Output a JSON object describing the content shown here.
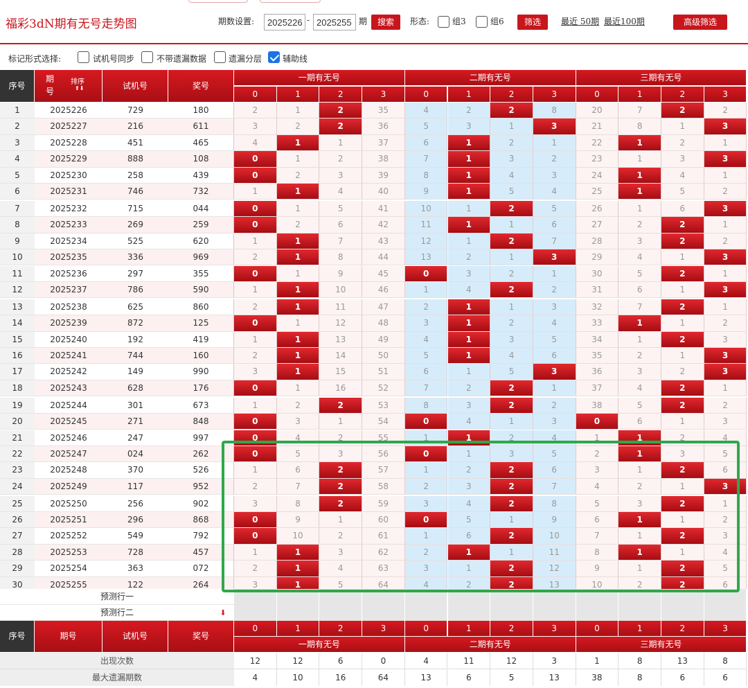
{
  "header": {
    "title": "福彩3dN期有无号走势图",
    "issue_label": "期数设置:",
    "from": "2025226",
    "dash": "-",
    "to": "2025255",
    "period_unit": "期",
    "search_btn": "搜索",
    "shape_label": "形态:",
    "group3": "组3",
    "group6": "组6",
    "filter_btn": "筛选",
    "recent50": "最近 50期",
    "recent100": "最近100期",
    "advanced_btn": "高级筛选"
  },
  "options": {
    "label": "标记形式选择:",
    "items": [
      {
        "label": "试机号同步",
        "checked": false
      },
      {
        "label": "不带遗漏数据",
        "checked": false
      },
      {
        "label": "遗漏分层",
        "checked": false
      },
      {
        "label": "辅助线",
        "checked": true
      }
    ]
  },
  "table": {
    "headers": {
      "seq": "序号",
      "issue": "期号",
      "sort": "排序",
      "test": "试机号",
      "prize": "奖号"
    },
    "groups": [
      "一期有无号",
      "二期有无号",
      "三期有无号"
    ],
    "digits": [
      "0",
      "1",
      "2",
      "3"
    ],
    "rows": [
      {
        "seq": "1",
        "issue": "2025226",
        "test": "729",
        "prize": "180",
        "vals": [
          "2",
          "1",
          "2",
          "35",
          "4",
          "2",
          "2",
          "8",
          "20",
          "7",
          "2",
          "2"
        ],
        "hits": [
          2,
          6,
          10
        ]
      },
      {
        "seq": "2",
        "issue": "2025227",
        "test": "216",
        "prize": "611",
        "vals": [
          "3",
          "2",
          "2",
          "36",
          "5",
          "3",
          "1",
          "3",
          "21",
          "8",
          "1",
          "3"
        ],
        "hits": [
          2,
          7,
          11
        ]
      },
      {
        "seq": "3",
        "issue": "2025228",
        "test": "451",
        "prize": "465",
        "vals": [
          "4",
          "1",
          "1",
          "37",
          "6",
          "1",
          "2",
          "1",
          "22",
          "1",
          "2",
          "1"
        ],
        "hits": [
          1,
          5,
          9
        ]
      },
      {
        "seq": "4",
        "issue": "2025229",
        "test": "888",
        "prize": "108",
        "vals": [
          "0",
          "1",
          "2",
          "38",
          "7",
          "1",
          "3",
          "2",
          "23",
          "1",
          "3",
          "3"
        ],
        "hits": [
          0,
          5,
          11
        ]
      },
      {
        "seq": "5",
        "issue": "2025230",
        "test": "258",
        "prize": "439",
        "vals": [
          "0",
          "2",
          "3",
          "39",
          "8",
          "1",
          "4",
          "3",
          "24",
          "1",
          "4",
          "1"
        ],
        "hits": [
          0,
          5,
          9
        ]
      },
      {
        "seq": "6",
        "issue": "2025231",
        "test": "746",
        "prize": "732",
        "vals": [
          "1",
          "1",
          "4",
          "40",
          "9",
          "1",
          "5",
          "4",
          "25",
          "1",
          "5",
          "2"
        ],
        "hits": [
          1,
          5,
          9
        ]
      },
      {
        "seq": "7",
        "issue": "2025232",
        "test": "715",
        "prize": "044",
        "vals": [
          "0",
          "1",
          "5",
          "41",
          "10",
          "1",
          "2",
          "5",
          "26",
          "1",
          "6",
          "3"
        ],
        "hits": [
          0,
          6,
          11
        ]
      },
      {
        "seq": "8",
        "issue": "2025233",
        "test": "269",
        "prize": "259",
        "vals": [
          "0",
          "2",
          "6",
          "42",
          "11",
          "1",
          "1",
          "6",
          "27",
          "2",
          "2",
          "1"
        ],
        "hits": [
          0,
          5,
          10
        ]
      },
      {
        "seq": "9",
        "issue": "2025234",
        "test": "525",
        "prize": "620",
        "vals": [
          "1",
          "1",
          "7",
          "43",
          "12",
          "1",
          "2",
          "7",
          "28",
          "3",
          "2",
          "2"
        ],
        "hits": [
          1,
          6,
          10
        ]
      },
      {
        "seq": "10",
        "issue": "2025235",
        "test": "336",
        "prize": "969",
        "vals": [
          "2",
          "1",
          "8",
          "44",
          "13",
          "2",
          "1",
          "3",
          "29",
          "4",
          "1",
          "3"
        ],
        "hits": [
          1,
          7,
          11
        ]
      },
      {
        "seq": "11",
        "issue": "2025236",
        "test": "297",
        "prize": "355",
        "vals": [
          "0",
          "1",
          "9",
          "45",
          "0",
          "3",
          "2",
          "1",
          "30",
          "5",
          "2",
          "1"
        ],
        "hits": [
          0,
          4,
          10
        ]
      },
      {
        "seq": "12",
        "issue": "2025237",
        "test": "786",
        "prize": "590",
        "vals": [
          "1",
          "1",
          "10",
          "46",
          "1",
          "4",
          "2",
          "2",
          "31",
          "6",
          "1",
          "3"
        ],
        "hits": [
          1,
          6,
          11
        ]
      },
      {
        "seq": "13",
        "issue": "2025238",
        "test": "625",
        "prize": "860",
        "vals": [
          "2",
          "1",
          "11",
          "47",
          "2",
          "1",
          "1",
          "3",
          "32",
          "7",
          "2",
          "1"
        ],
        "hits": [
          1,
          5,
          10
        ]
      },
      {
        "seq": "14",
        "issue": "2025239",
        "test": "872",
        "prize": "125",
        "vals": [
          "0",
          "1",
          "12",
          "48",
          "3",
          "1",
          "2",
          "4",
          "33",
          "1",
          "1",
          "2"
        ],
        "hits": [
          0,
          5,
          9
        ]
      },
      {
        "seq": "15",
        "issue": "2025240",
        "test": "192",
        "prize": "419",
        "vals": [
          "1",
          "1",
          "13",
          "49",
          "4",
          "1",
          "3",
          "5",
          "34",
          "1",
          "2",
          "3"
        ],
        "hits": [
          1,
          5,
          10
        ]
      },
      {
        "seq": "16",
        "issue": "2025241",
        "test": "744",
        "prize": "160",
        "vals": [
          "2",
          "1",
          "14",
          "50",
          "5",
          "1",
          "4",
          "6",
          "35",
          "2",
          "1",
          "3"
        ],
        "hits": [
          1,
          5,
          11
        ]
      },
      {
        "seq": "17",
        "issue": "2025242",
        "test": "149",
        "prize": "990",
        "vals": [
          "3",
          "1",
          "15",
          "51",
          "6",
          "1",
          "5",
          "3",
          "36",
          "3",
          "2",
          "3"
        ],
        "hits": [
          1,
          7,
          11
        ]
      },
      {
        "seq": "18",
        "issue": "2025243",
        "test": "628",
        "prize": "176",
        "vals": [
          "0",
          "1",
          "16",
          "52",
          "7",
          "2",
          "2",
          "1",
          "37",
          "4",
          "2",
          "1"
        ],
        "hits": [
          0,
          6,
          10
        ]
      },
      {
        "seq": "19",
        "issue": "2025244",
        "test": "301",
        "prize": "673",
        "vals": [
          "1",
          "2",
          "2",
          "53",
          "8",
          "3",
          "2",
          "2",
          "38",
          "5",
          "2",
          "2"
        ],
        "hits": [
          2,
          6,
          10
        ]
      },
      {
        "seq": "20",
        "issue": "2025245",
        "test": "271",
        "prize": "848",
        "vals": [
          "0",
          "3",
          "1",
          "54",
          "0",
          "4",
          "1",
          "3",
          "0",
          "6",
          "1",
          "3"
        ],
        "hits": [
          0,
          4,
          8
        ]
      },
      {
        "seq": "21",
        "issue": "2025246",
        "test": "247",
        "prize": "997",
        "vals": [
          "0",
          "4",
          "2",
          "55",
          "1",
          "1",
          "2",
          "4",
          "1",
          "1",
          "2",
          "4"
        ],
        "hits": [
          0,
          5,
          9
        ]
      },
      {
        "seq": "22",
        "issue": "2025247",
        "test": "024",
        "prize": "262",
        "vals": [
          "0",
          "5",
          "3",
          "56",
          "0",
          "1",
          "3",
          "5",
          "2",
          "1",
          "3",
          "5"
        ],
        "hits": [
          0,
          4,
          9
        ]
      },
      {
        "seq": "23",
        "issue": "2025248",
        "test": "370",
        "prize": "526",
        "vals": [
          "1",
          "6",
          "2",
          "57",
          "1",
          "2",
          "2",
          "6",
          "3",
          "1",
          "2",
          "6"
        ],
        "hits": [
          2,
          6,
          10
        ]
      },
      {
        "seq": "24",
        "issue": "2025249",
        "test": "117",
        "prize": "952",
        "vals": [
          "2",
          "7",
          "2",
          "58",
          "2",
          "3",
          "2",
          "7",
          "4",
          "2",
          "1",
          "3"
        ],
        "hits": [
          2,
          6,
          11
        ]
      },
      {
        "seq": "25",
        "issue": "2025250",
        "test": "256",
        "prize": "902",
        "vals": [
          "3",
          "8",
          "2",
          "59",
          "3",
          "4",
          "2",
          "8",
          "5",
          "3",
          "2",
          "1"
        ],
        "hits": [
          2,
          6,
          10
        ]
      },
      {
        "seq": "26",
        "issue": "2025251",
        "test": "296",
        "prize": "868",
        "vals": [
          "0",
          "9",
          "1",
          "60",
          "0",
          "5",
          "1",
          "9",
          "6",
          "1",
          "1",
          "2"
        ],
        "hits": [
          0,
          4,
          9
        ]
      },
      {
        "seq": "27",
        "issue": "2025252",
        "test": "549",
        "prize": "792",
        "vals": [
          "0",
          "10",
          "2",
          "61",
          "1",
          "6",
          "2",
          "10",
          "7",
          "1",
          "2",
          "3"
        ],
        "hits": [
          0,
          6,
          10
        ]
      },
      {
        "seq": "28",
        "issue": "2025253",
        "test": "728",
        "prize": "457",
        "vals": [
          "1",
          "1",
          "3",
          "62",
          "2",
          "1",
          "1",
          "11",
          "8",
          "1",
          "1",
          "4"
        ],
        "hits": [
          1,
          5,
          9
        ]
      },
      {
        "seq": "29",
        "issue": "2025254",
        "test": "363",
        "prize": "072",
        "vals": [
          "2",
          "1",
          "4",
          "63",
          "3",
          "1",
          "2",
          "12",
          "9",
          "1",
          "2",
          "5"
        ],
        "hits": [
          1,
          6,
          10
        ]
      },
      {
        "seq": "30",
        "issue": "2025255",
        "test": "122",
        "prize": "264",
        "vals": [
          "3",
          "1",
          "5",
          "64",
          "4",
          "2",
          "2",
          "13",
          "10",
          "2",
          "2",
          "6"
        ],
        "hits": [
          1,
          6,
          10
        ]
      }
    ],
    "predict1": "预测行一",
    "predict2": "预测行二",
    "stats": {
      "appear_label": "出现次数",
      "appear": [
        "12",
        "12",
        "6",
        "0",
        "4",
        "11",
        "12",
        "3",
        "1",
        "8",
        "13",
        "8"
      ],
      "maxmiss_label": "最大遗漏期数",
      "maxmiss": [
        "4",
        "10",
        "16",
        "64",
        "13",
        "6",
        "5",
        "13",
        "38",
        "8",
        "6",
        "6"
      ]
    }
  },
  "colors": {
    "accent": "#c8161d",
    "blue_zone": "#d6ecfa",
    "pink_zone": "#fdf0f0",
    "highlight": "#2ea84a"
  }
}
